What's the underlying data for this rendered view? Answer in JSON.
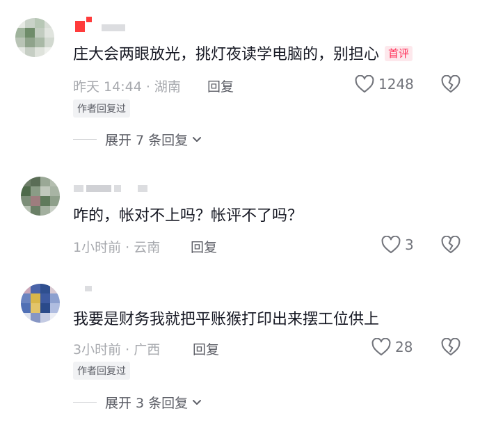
{
  "comments": [
    {
      "text": "庄大会两眼放光，挑灯夜读学电脑的，别担心",
      "badge": "首评",
      "time": "昨天 14:44 · 湖南",
      "reply": "回复",
      "likes": "1248",
      "author_replied": "作者回复过",
      "expand": "展开 7 条回复"
    },
    {
      "text": "咋的，帐对不上吗？帐评不了吗？",
      "time": "1小时前 · 云南",
      "reply": "回复",
      "likes": "3"
    },
    {
      "text": "我要是财务我就把平账猴打印出来摆工位供上",
      "time": "3小时前 · 广西",
      "reply": "回复",
      "likes": "28",
      "author_replied": "作者回复过",
      "expand": "展开 3 条回复"
    }
  ],
  "icons": {
    "like": "heart-outline-icon",
    "dislike": "broken-heart-icon",
    "expand": "chevron-down-icon"
  },
  "colors": {
    "text": "#161823",
    "meta": "#a6a8ad",
    "accent": "#fe2c55"
  }
}
